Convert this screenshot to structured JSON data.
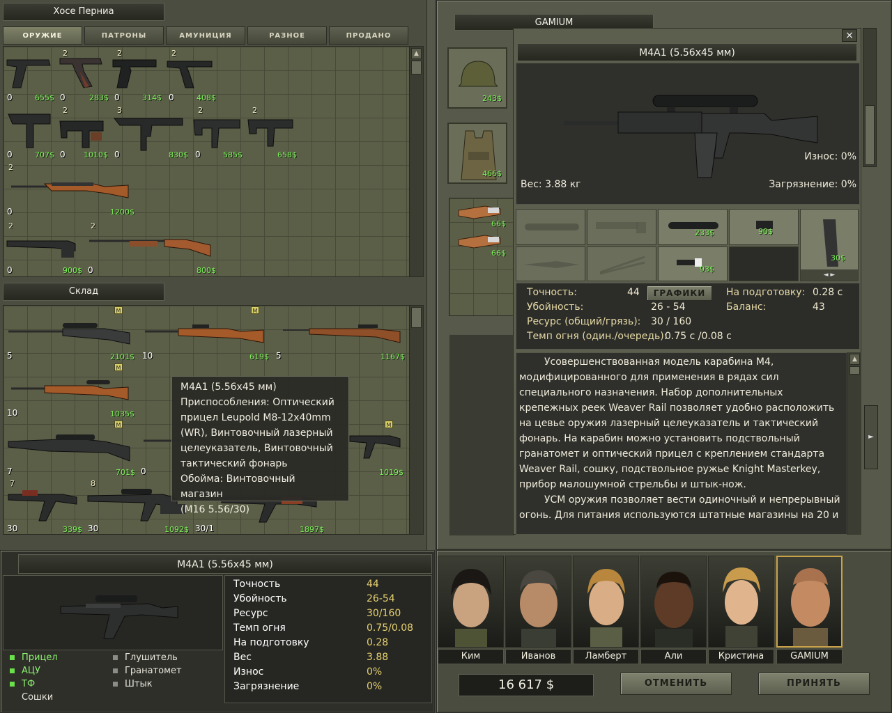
{
  "left": {
    "owner": "Хосе Перниа",
    "tabs": [
      "ОРУЖИЕ",
      "ПАТРОНЫ",
      "АМУНИЦИЯ",
      "РАЗНОЕ",
      "ПРОДАНО"
    ],
    "items": [
      {
        "qty": "",
        "count": "0",
        "price": "655$",
        "icon": "pistol-icon"
      },
      {
        "qty": "2",
        "count": "0",
        "price": "283$",
        "icon": "pistol-icon"
      },
      {
        "qty": "2",
        "count": "0",
        "price": "314$",
        "icon": "pistol-icon"
      },
      {
        "qty": "2",
        "count": "0",
        "price": "408$",
        "icon": "pistol-icon"
      },
      {
        "qty": "",
        "count": "0",
        "price": "707$",
        "icon": "smg-icon"
      },
      {
        "qty": "2",
        "count": "0",
        "price": "1010$",
        "icon": "smg-icon"
      },
      {
        "qty": "3",
        "count": "0",
        "price": "830$",
        "icon": "smg-icon"
      },
      {
        "qty": "2",
        "count": "0",
        "price": "585$",
        "icon": "smg-icon"
      },
      {
        "qty": "2",
        "count": "",
        "price": "658$",
        "icon": "smg-icon"
      },
      {
        "qty": "2",
        "count": "0",
        "price": "1200$",
        "icon": "rifle-icon"
      },
      {
        "qty": "2",
        "count": "0",
        "price": "900$",
        "icon": "shotgun-icon"
      },
      {
        "qty": "2",
        "count": "0",
        "price": "800$",
        "icon": "shotgun-icon"
      }
    ]
  },
  "storage": {
    "title": "Склад",
    "mark": "M",
    "items": [
      {
        "count": "5",
        "price": "2101$",
        "icon": "sniper-rifle-icon"
      },
      {
        "count": "10",
        "price": "619$",
        "icon": "rifle-icon"
      },
      {
        "count": "5",
        "price": "1167$",
        "icon": "rifle-icon"
      },
      {
        "count": "10",
        "price": "1035$",
        "icon": "rifle-icon"
      },
      {
        "count": "7",
        "price": "701$",
        "icon": "shotgun-icon"
      },
      {
        "count": "0",
        "price": "",
        "icon": "rifle-icon"
      },
      {
        "count": "",
        "price": "1019$",
        "icon": "assault-rifle-icon"
      },
      {
        "qty": "7",
        "count": "30",
        "price": "339$",
        "icon": "assault-rifle-icon"
      },
      {
        "qty": "8",
        "count": "30",
        "price": "1092$",
        "icon": "assault-rifle-icon"
      },
      {
        "count": "30/1",
        "price": "1897$",
        "icon": "assault-rifle-icon"
      }
    ]
  },
  "tooltip": {
    "lines": [
      "M4A1 (5.56x45 мм)",
      "Приспособления: Оптический",
      "прицел Leupold M8-12x40mm",
      "(WR), Винтовочный лазерный",
      "целеуказатель, Винтовочный",
      "тактический фонарь",
      "Обойма: Винтовочный магазин",
      "(M16 5.56/30)"
    ]
  },
  "bottom_left": {
    "title": "M4A1 (5.56x45 мм)",
    "options": [
      {
        "label": "Прицел",
        "active": true
      },
      {
        "label": "АЦУ",
        "active": true
      },
      {
        "label": "ТФ",
        "active": true
      },
      {
        "label": "Сошки",
        "active": false
      },
      {
        "label": "Глушитель",
        "active": false
      },
      {
        "label": "Гранатомет",
        "active": false
      },
      {
        "label": "Штык",
        "active": false
      }
    ],
    "stats": [
      {
        "label": "Точность",
        "value": "44"
      },
      {
        "label": "Убойность",
        "value": "26-54"
      },
      {
        "label": "Ресурс",
        "value": "30/160"
      },
      {
        "label": "Темп огня",
        "value": "0.75/0.08"
      },
      {
        "label": "На подготовку",
        "value": "0.28"
      },
      {
        "label": "Вес",
        "value": "3.88"
      },
      {
        "label": "Износ",
        "value": "0%"
      },
      {
        "label": "Загрязнение",
        "value": "0%"
      }
    ]
  },
  "right": {
    "owner": "GAMIUM",
    "close": "×",
    "inventory": [
      {
        "price": "243$",
        "icon": "helmet-icon"
      },
      {
        "price": "466$",
        "icon": "vest-icon"
      },
      {
        "price": "66$",
        "icon": "ammo-box-icon"
      },
      {
        "price": "66$",
        "icon": "ammo-box-icon"
      }
    ],
    "detail": {
      "title": "M4A1 (5.56x45 мм)",
      "wear": "Износ: 0%",
      "weight": "Вес: 3.88 кг",
      "dirt": "Загрязнение: 0%",
      "attachments": [
        {
          "price": "",
          "icon": "silencer-icon"
        },
        {
          "price": "",
          "icon": "grenade-launcher-icon"
        },
        {
          "price": "233$",
          "icon": "scope-icon"
        },
        {
          "price": "90$",
          "icon": "laser-icon"
        },
        {
          "price": "30$",
          "icon": "magazine-icon"
        },
        {
          "price": "",
          "icon": "bayonet-icon"
        },
        {
          "price": "",
          "icon": "bipod-icon"
        },
        {
          "price": "93$",
          "icon": "flashlight-icon"
        }
      ],
      "stats": {
        "accuracy_label": "Точность:",
        "accuracy": "44",
        "graphs": "ГРАФИКИ",
        "prep_label": "На подготовку:",
        "prep": "0.28 с",
        "damage_label": "Убойность:",
        "damage": "26 - 54",
        "balance_label": "Баланс:",
        "balance": "43",
        "resource_label": "Ресурс (общий/грязь):",
        "resource": "30 / 160",
        "rate_label": "Темп огня (один./очередь):",
        "rate": "0.75 с /0.08 с"
      },
      "description": [
        "Усовершенствованная модель карабина M4, модифицированного для применения в рядах сил специального назначения. Набор дополнительных крепежных реек Weaver Rail позволяет удобно расположить на цевье оружия лазерный целеуказатель и тактический фонарь. На карабин можно установить подствольный гранатомет и оптический прицел с креплением стандарта Weaver Rail, сошку, подствольное ружье Knight Masterkey, прибор малошумной стрельбы и штык-нож.",
        "УСМ оружия позволяет вести одиночный и непрерывный огонь. Для питания используются штатные магазины на 20 и"
      ]
    }
  },
  "team": [
    {
      "name": "Ким",
      "skin": "#c9a27f",
      "hair": "#1a1714"
    },
    {
      "name": "Иванов",
      "skin": "#b78a68",
      "hair": "#4a4640"
    },
    {
      "name": "Ламберт",
      "skin": "#d9ad86",
      "hair": "#b8863c"
    },
    {
      "name": "Али",
      "skin": "#5e3b27",
      "hair": "#1c120c"
    },
    {
      "name": "Кристина",
      "skin": "#e0b58e",
      "hair": "#c99b4c"
    },
    {
      "name": "GAMIUM",
      "skin": "#c48b63",
      "hair": "#a8724f"
    }
  ],
  "footer": {
    "money": "16 617 $",
    "cancel": "ОТМЕНИТЬ",
    "accept": "ПРИНЯТЬ"
  },
  "colors": {
    "price": "#7cf05a",
    "selected_border": "#c9a349"
  }
}
